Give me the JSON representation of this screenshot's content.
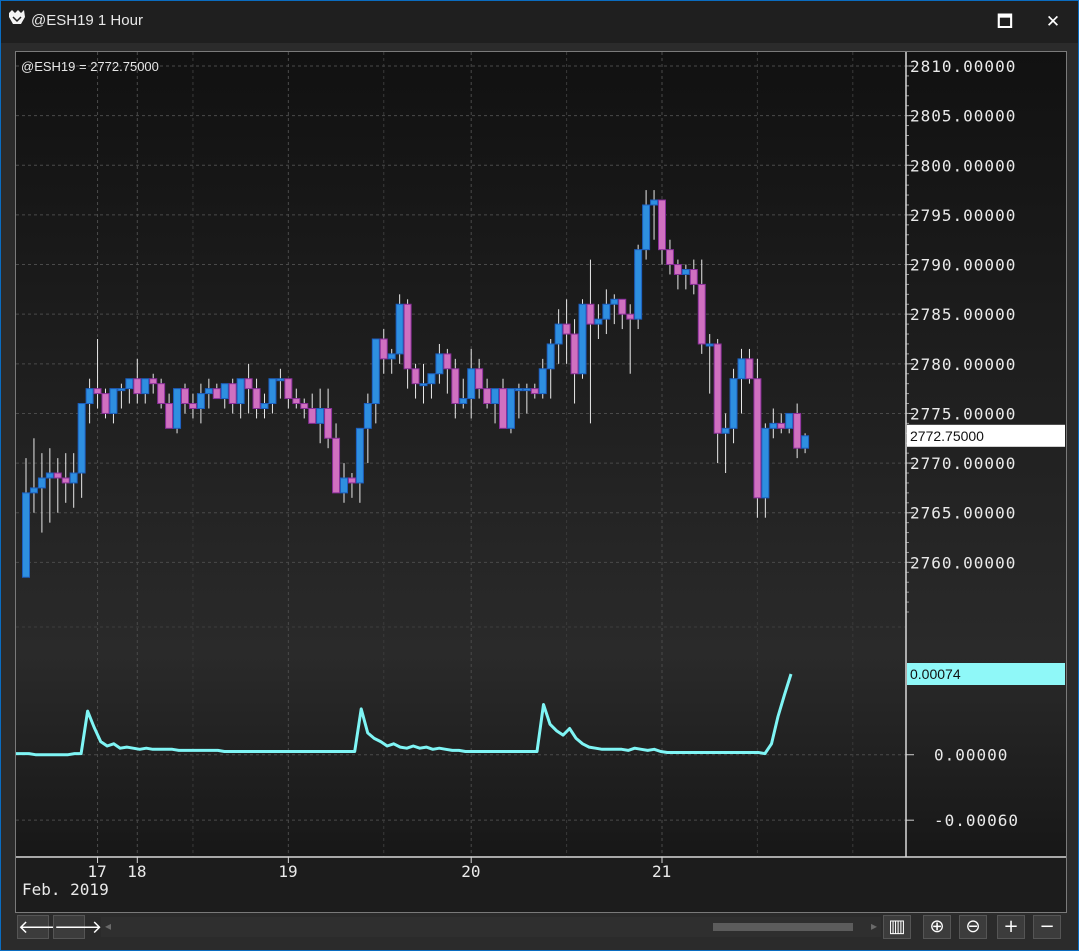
{
  "window": {
    "title": "@ESH19 1 Hour",
    "maximize_glyph": "🗖",
    "close_glyph": "✕"
  },
  "chart_data": {
    "type": "candlestick",
    "symbol_label": "@ESH19 = 2772.75000",
    "last_price_label": "2772.75000",
    "price_axis": {
      "ylim": [
        2755,
        2810
      ],
      "ticks": [
        "2810.00000",
        "2805.00000",
        "2800.00000",
        "2795.00000",
        "2790.00000",
        "2785.00000",
        "2780.00000",
        "2775.00000",
        "2770.00000",
        "2765.00000",
        "2760.00000"
      ],
      "tick_values": [
        2810,
        2805,
        2800,
        2795,
        2790,
        2785,
        2780,
        2775,
        2770,
        2765,
        2760
      ]
    },
    "indicator": {
      "last_value_label": "0.00074",
      "ylim": [
        -0.0008,
        0.00085
      ],
      "ticks": [
        "0.00000",
        "-0.00060"
      ],
      "tick_values": [
        0,
        -0.0006
      ],
      "color": "#7ff5f5",
      "values": [
        1e-05,
        1e-05,
        1e-05,
        0.0,
        0.0,
        0.0,
        0.0,
        0.0,
        0.0,
        1e-05,
        1e-05,
        0.0004,
        0.00025,
        0.00012,
        8e-05,
        0.0001,
        6e-05,
        7e-05,
        6e-05,
        5e-05,
        6e-05,
        5e-05,
        5e-05,
        5e-05,
        5e-05,
        4e-05,
        4e-05,
        4e-05,
        4e-05,
        4e-05,
        4e-05,
        4e-05,
        3e-05,
        3e-05,
        3e-05,
        3e-05,
        3e-05,
        3e-05,
        3e-05,
        3e-05,
        3e-05,
        3e-05,
        3e-05,
        3e-05,
        3e-05,
        3e-05,
        3e-05,
        3e-05,
        3e-05,
        3e-05,
        3e-05,
        3e-05,
        3e-05,
        0.00042,
        0.0002,
        0.00015,
        0.00012,
        8e-05,
        0.0001,
        7e-05,
        6e-05,
        8e-05,
        6e-05,
        7e-05,
        5e-05,
        6e-05,
        5e-05,
        4e-05,
        4e-05,
        3e-05,
        3e-05,
        3e-05,
        3e-05,
        3e-05,
        3e-05,
        3e-05,
        3e-05,
        3e-05,
        3e-05,
        3e-05,
        3e-05,
        0.00046,
        0.00028,
        0.00022,
        0.00018,
        0.00024,
        0.00015,
        0.0001,
        7e-05,
        6e-05,
        5e-05,
        5e-05,
        5e-05,
        5e-05,
        4e-05,
        6e-05,
        5e-05,
        4e-05,
        5e-05,
        3e-05,
        2e-05,
        2e-05,
        2e-05,
        2e-05,
        2e-05,
        2e-05,
        2e-05,
        2e-05,
        2e-05,
        2e-05,
        2e-05,
        2e-05,
        2e-05,
        2e-05,
        2e-05,
        1e-05,
        0.0001,
        0.00035,
        0.00055,
        0.00074
      ]
    },
    "x_axis": {
      "ticks": [
        {
          "label": "17",
          "bar": 9
        },
        {
          "label": "18",
          "bar": 14
        },
        {
          "label": "19",
          "bar": 33
        },
        {
          "label": "20",
          "bar": 56
        },
        {
          "label": "21",
          "bar": 80
        }
      ],
      "period_label": "Feb. 2019"
    },
    "up_color": "#2e8fe0",
    "down_color": "#d070c0",
    "candles": [
      [
        2758.5,
        2770.5,
        2758.5,
        2767.0
      ],
      [
        2767.0,
        2772.5,
        2765.0,
        2767.5
      ],
      [
        2767.5,
        2771.0,
        2763.0,
        2768.5
      ],
      [
        2768.5,
        2771.5,
        2764.0,
        2769.0
      ],
      [
        2769.0,
        2770.5,
        2765.0,
        2768.5
      ],
      [
        2768.5,
        2771.0,
        2766.0,
        2768.0
      ],
      [
        2768.0,
        2771.0,
        2765.5,
        2769.0
      ],
      [
        2769.0,
        2775.5,
        2766.5,
        2776.0
      ],
      [
        2776.0,
        2778.5,
        2774.0,
        2777.5
      ],
      [
        2777.5,
        2782.5,
        2775.5,
        2777.0
      ],
      [
        2777.0,
        2777.5,
        2774.5,
        2775.0
      ],
      [
        2775.0,
        2777.5,
        2774.0,
        2777.5
      ],
      [
        2777.5,
        2778.0,
        2775.5,
        2777.5
      ],
      [
        2777.5,
        2778.5,
        2776.0,
        2778.5
      ],
      [
        2778.5,
        2780.5,
        2776.0,
        2777.0
      ],
      [
        2777.0,
        2778.0,
        2776.0,
        2778.5
      ],
      [
        2778.5,
        2779.0,
        2777.0,
        2778.0
      ],
      [
        2778.0,
        2778.5,
        2775.5,
        2776.0
      ],
      [
        2776.0,
        2777.0,
        2774.0,
        2773.5
      ],
      [
        2773.5,
        2777.5,
        2773.0,
        2777.5
      ],
      [
        2777.5,
        2778.0,
        2775.0,
        2776.0
      ],
      [
        2776.0,
        2777.0,
        2774.5,
        2775.5
      ],
      [
        2775.5,
        2778.0,
        2774.0,
        2777.0
      ],
      [
        2777.0,
        2778.5,
        2775.5,
        2777.5
      ],
      [
        2777.5,
        2778.0,
        2776.5,
        2776.5
      ],
      [
        2776.5,
        2778.0,
        2775.5,
        2778.0
      ],
      [
        2778.0,
        2778.5,
        2775.0,
        2776.0
      ],
      [
        2776.0,
        2778.0,
        2774.5,
        2778.5
      ],
      [
        2778.5,
        2780.0,
        2775.0,
        2777.5
      ],
      [
        2777.5,
        2778.5,
        2774.5,
        2775.5
      ],
      [
        2775.5,
        2777.0,
        2774.5,
        2776.0
      ],
      [
        2776.0,
        2778.5,
        2775.0,
        2778.5
      ],
      [
        2778.5,
        2779.5,
        2776.5,
        2778.5
      ],
      [
        2778.5,
        2778.5,
        2775.5,
        2776.5
      ],
      [
        2776.5,
        2777.5,
        2775.5,
        2776.0
      ],
      [
        2776.0,
        2776.5,
        2774.5,
        2775.5
      ],
      [
        2775.5,
        2777.0,
        2774.0,
        2774.0
      ],
      [
        2774.0,
        2777.5,
        2772.0,
        2775.5
      ],
      [
        2775.5,
        2777.5,
        2771.5,
        2772.5
      ],
      [
        2772.5,
        2774.0,
        2768.0,
        2767.0
      ],
      [
        2767.0,
        2770.0,
        2766.0,
        2768.5
      ],
      [
        2768.5,
        2769.0,
        2766.5,
        2768.0
      ],
      [
        2768.0,
        2771.5,
        2766.0,
        2773.5
      ],
      [
        2773.5,
        2777.0,
        2770.0,
        2776.0
      ],
      [
        2776.0,
        2780.0,
        2774.0,
        2782.5
      ],
      [
        2782.5,
        2783.5,
        2779.0,
        2780.5
      ],
      [
        2780.5,
        2781.5,
        2779.0,
        2781.0
      ],
      [
        2781.0,
        2787.0,
        2780.0,
        2786.0
      ],
      [
        2786.0,
        2786.5,
        2777.5,
        2779.5
      ],
      [
        2779.5,
        2780.0,
        2776.5,
        2778.0
      ],
      [
        2778.0,
        2780.0,
        2776.0,
        2778.0
      ],
      [
        2778.0,
        2779.0,
        2776.5,
        2779.0
      ],
      [
        2779.0,
        2782.0,
        2778.0,
        2781.0
      ],
      [
        2781.0,
        2781.5,
        2777.0,
        2779.5
      ],
      [
        2779.5,
        2780.5,
        2774.5,
        2776.0
      ],
      [
        2776.0,
        2778.5,
        2775.5,
        2776.5
      ],
      [
        2776.5,
        2781.5,
        2774.5,
        2779.5
      ],
      [
        2779.5,
        2780.5,
        2776.5,
        2777.5
      ],
      [
        2777.5,
        2778.5,
        2775.5,
        2776.0
      ],
      [
        2776.0,
        2777.5,
        2774.0,
        2777.5
      ],
      [
        2777.5,
        2778.5,
        2773.5,
        2773.5
      ],
      [
        2773.5,
        2777.0,
        2773.0,
        2777.5
      ],
      [
        2777.5,
        2778.0,
        2774.5,
        2777.5
      ],
      [
        2777.5,
        2778.0,
        2775.0,
        2777.5
      ],
      [
        2777.5,
        2778.0,
        2776.5,
        2777.0
      ],
      [
        2777.0,
        2780.5,
        2776.5,
        2779.5
      ],
      [
        2779.5,
        2782.5,
        2776.5,
        2782.0
      ],
      [
        2782.0,
        2785.5,
        2780.0,
        2784.0
      ],
      [
        2784.0,
        2786.5,
        2780.0,
        2783.0
      ],
      [
        2783.0,
        2784.5,
        2776.0,
        2779.0
      ],
      [
        2779.0,
        2786.5,
        2778.5,
        2786.0
      ],
      [
        2786.0,
        2790.5,
        2774.0,
        2784.0
      ],
      [
        2784.0,
        2786.0,
        2782.5,
        2784.5
      ],
      [
        2784.5,
        2787.5,
        2783.0,
        2786.0
      ],
      [
        2786.0,
        2787.0,
        2784.0,
        2786.5
      ],
      [
        2786.5,
        2786.5,
        2783.5,
        2785.0
      ],
      [
        2785.0,
        2786.0,
        2779.0,
        2784.5
      ],
      [
        2784.5,
        2792.0,
        2783.5,
        2791.5
      ],
      [
        2791.5,
        2797.5,
        2790.5,
        2796.0
      ],
      [
        2796.0,
        2797.5,
        2792.5,
        2796.5
      ],
      [
        2796.5,
        2796.5,
        2790.0,
        2791.5
      ],
      [
        2791.5,
        2792.5,
        2789.0,
        2790.0
      ],
      [
        2790.0,
        2790.5,
        2787.5,
        2789.0
      ],
      [
        2789.0,
        2790.0,
        2787.5,
        2789.5
      ],
      [
        2789.5,
        2790.5,
        2787.0,
        2788.0
      ],
      [
        2788.0,
        2790.5,
        2781.0,
        2782.0
      ],
      [
        2782.0,
        2783.0,
        2777.0,
        2782.0
      ],
      [
        2782.0,
        2782.5,
        2770.0,
        2773.0
      ],
      [
        2773.0,
        2775.0,
        2769.0,
        2773.5
      ],
      [
        2773.5,
        2779.5,
        2772.0,
        2778.5
      ],
      [
        2778.5,
        2781.5,
        2775.0,
        2780.5
      ],
      [
        2780.5,
        2781.5,
        2778.0,
        2778.5
      ],
      [
        2778.5,
        2780.5,
        2764.5,
        2766.5
      ],
      [
        2766.5,
        2774.0,
        2764.5,
        2773.5
      ],
      [
        2773.5,
        2775.5,
        2772.5,
        2774.0
      ],
      [
        2774.0,
        2775.0,
        2773.0,
        2773.5
      ],
      [
        2773.5,
        2775.0,
        2773.0,
        2775.0
      ],
      [
        2775.0,
        2776.0,
        2770.5,
        2771.5
      ],
      [
        2771.5,
        2773.0,
        2771.0,
        2772.75
      ]
    ]
  },
  "bottombar": {
    "left_glyph": "🡐",
    "right_glyph": "🡒",
    "scroll_left_glyph": "◂",
    "scroll_right_glyph": "▸",
    "tools": [
      "▥",
      "⊕",
      "⊖",
      "+",
      "−"
    ]
  }
}
